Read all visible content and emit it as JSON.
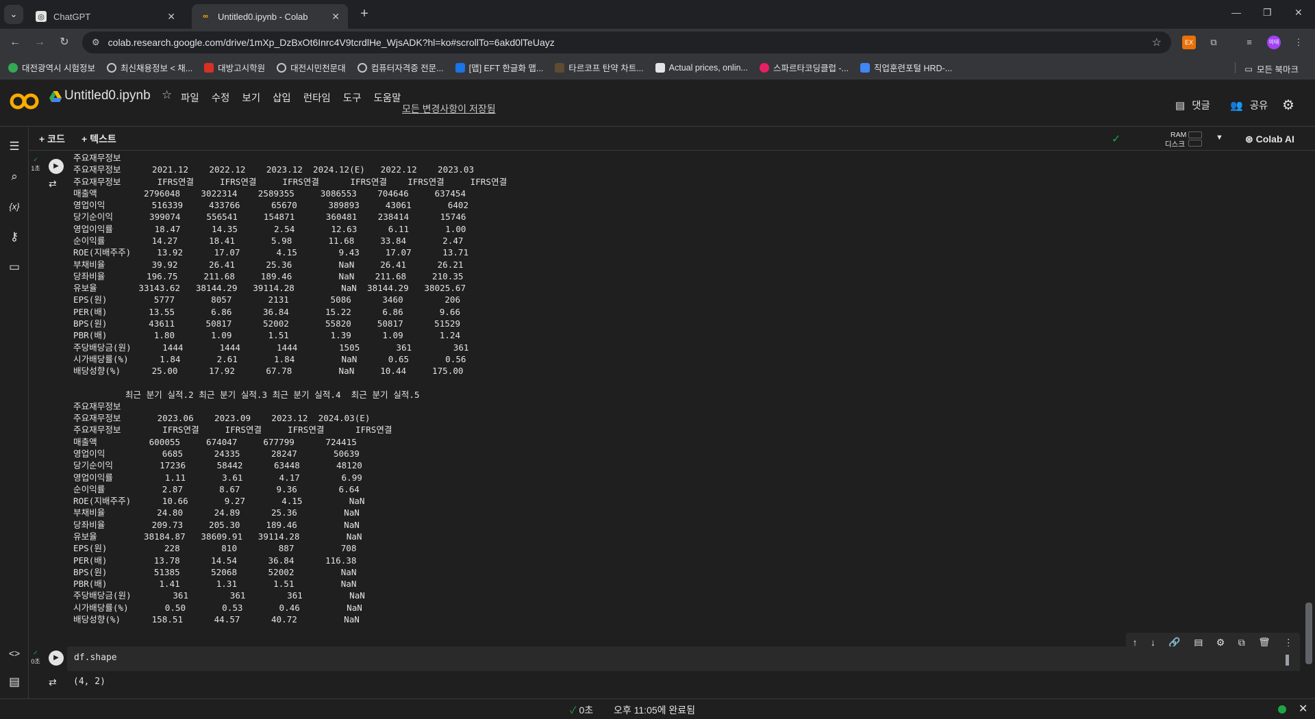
{
  "browser": {
    "tabs": [
      {
        "title": "ChatGPT",
        "active": false
      },
      {
        "title": "Untitled0.ipynb - Colab",
        "active": true
      }
    ],
    "url": "colab.research.google.com/drive/1mXp_DzBxOt6Inrc4V9tcrdlHe_WjsADK?hl=ko#scrollTo=6akd0lTeUayz",
    "bookmarks": [
      "대전광역시 시험정보",
      "최신채용정보 < 채...",
      "대방고시학원",
      "대전시민천문대",
      "컴퓨터자격증 전문...",
      "[맵] EFT 한글화 맵...",
      "타르코프 탄약 차트...",
      "Actual prices, onlin...",
      "스파르타코딩클럽 -...",
      "직업훈련포털 HRD-..."
    ],
    "bookmarks_all": "모든 북마크",
    "profile": "의태"
  },
  "colab": {
    "notebook_title": "Untitled0.ipynb",
    "menu": [
      "파일",
      "수정",
      "보기",
      "삽입",
      "런타임",
      "도구",
      "도움말"
    ],
    "save_status": "모든 변경사항이 저장됨",
    "comment_label": "댓글",
    "share_label": "공유",
    "add_code": "+ 코드",
    "add_text": "+ 텍스트",
    "ram_label": "RAM",
    "disk_label": "디스크",
    "colab_ai": "Colab AI"
  },
  "cells": {
    "cell1_exec_time": "1초",
    "cell1_output": "주요재무정보\n주요재무정보      2021.12    2022.12    2023.12  2024.12(E)   2022.12    2023.03\n주요재무정보       IFRS연결     IFRS연결     IFRS연결      IFRS연결    IFRS연결     IFRS연결\n매출액         2796048    3022314    2589355     3086553    704646     637454\n영업이익         516339     433766      65670      389893     43061       6402\n당기순이익       399074     556541     154871      360481    238414      15746\n영업이익률        18.47      14.35       2.54       12.63      6.11       1.00\n순이익률         14.27      18.41       5.98       11.68     33.84       2.47\nROE(지배주주)     13.92      17.07       4.15        9.43     17.07      13.71\n부채비율         39.92      26.41      25.36         NaN     26.41      26.21\n당좌비율        196.75     211.68     189.46         NaN    211.68     210.35\n유보율        33143.62   38144.29   39114.28         NaN  38144.29   38025.67\nEPS(원)         5777       8057       2131        5086      3460        206\nPER(배)        13.55       6.86      36.84       15.22      6.86       9.66\nBPS(원)        43611      50817      52002       55820     50817      51529\nPBR(배)         1.80       1.09       1.51        1.39      1.09       1.24\n주당배당금(원)      1444       1444       1444        1505       361        361\n시가배당률(%)      1.84       2.61       1.84         NaN      0.65       0.56\n배당성향(%)      25.00      17.92      67.78         NaN     10.44     175.00\n\n          최근 분기 실적.2 최근 분기 실적.3 최근 분기 실적.4  최근 분기 실적.5\n주요재무정보\n주요재무정보       2023.06    2023.09    2023.12  2024.03(E)\n주요재무정보        IFRS연결     IFRS연결     IFRS연결      IFRS연결\n매출액          600055     674047     677799      724415\n영업이익           6685      24335      28247       50639\n당기순이익         17236      58442      63448       48120\n영업이익률          1.11       3.61       4.17        6.99\n순이익률           2.87       8.67       9.36        6.64\nROE(지배주주)      10.66       9.27       4.15         NaN\n부채비율          24.80      24.89      25.36         NaN\n당좌비율         209.73     205.30     189.46         NaN\n유보율         38184.87   38609.91   39114.28         NaN\nEPS(원)           228        810        887         708\nPER(배)         13.78      14.54      36.84      116.38\nBPS(원)         51385      52068      52002         NaN\nPBR(배)          1.41       1.31       1.51         NaN\n주당배당금(원)        361        361        361         NaN\n시가배당률(%)       0.50       0.53       0.46         NaN\n배당성향(%)      158.51      44.57      40.72         NaN",
    "cell2_exec_time": "0초",
    "cell2_code": "df.shape",
    "cell2_output": "(4, 2)"
  },
  "status": {
    "elapsed": "0초",
    "completed": "오후 11:05에 완료됨"
  },
  "colors": {
    "background": "#1f1f1f",
    "chrome": "#35363a",
    "success": "#1ea446",
    "logo_orange": "#f9ab00"
  }
}
